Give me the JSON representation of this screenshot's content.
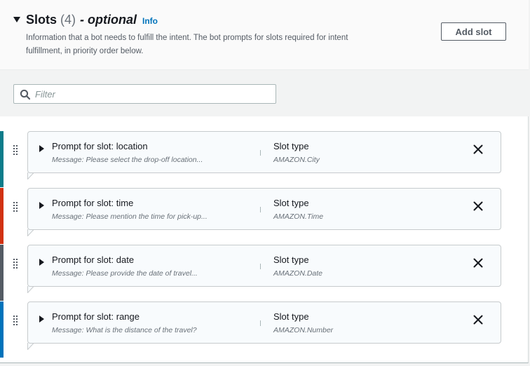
{
  "section": {
    "title": "Slots",
    "count": "(4)",
    "optional": "- optional",
    "info_link": "Info",
    "description": "Information that a bot needs to fulfill the intent. The bot prompts for slots required for intent fulfillment, in priority order below.",
    "add_slot_label": "Add slot"
  },
  "filter": {
    "placeholder": "Filter",
    "value": ""
  },
  "slots": [
    {
      "title": "Prompt for slot: location",
      "message": "Message: Please select the drop-off location...",
      "type_label": "Slot type",
      "type_value": "AMAZON.City",
      "accent_color": "#0d7c8a"
    },
    {
      "title": "Prompt for slot: time",
      "message": "Message: Please mention the time for pick-up...",
      "type_label": "Slot type",
      "type_value": "AMAZON.Time",
      "accent_color": "#d13212"
    },
    {
      "title": "Prompt for slot: date",
      "message": "Message: Please provide the date of travel...",
      "type_label": "Slot type",
      "type_value": "AMAZON.Date",
      "accent_color": "#545b64"
    },
    {
      "title": "Prompt for slot: range",
      "message": "Message: What is the distance of the travel?",
      "type_label": "Slot type",
      "type_value": "AMAZON.Number",
      "accent_color": "#0073bb"
    }
  ],
  "icons": {
    "expand_section": "caret-down-icon",
    "filter": "search-icon",
    "drag": "drag-handle-icon",
    "expand_slot": "caret-right-icon",
    "remove": "close-icon"
  }
}
